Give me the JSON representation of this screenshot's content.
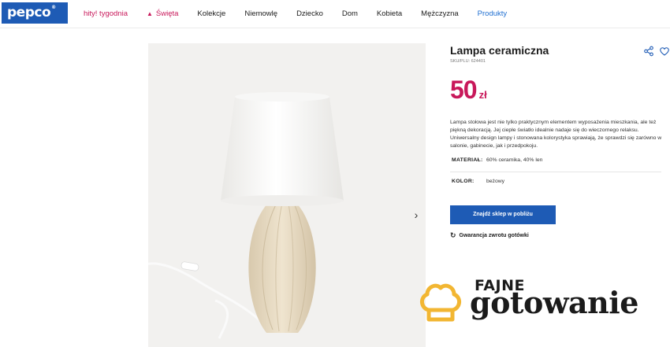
{
  "header": {
    "logo_text": "pepco",
    "logo_reg": "®",
    "nav": [
      {
        "label": "hity! tygodnia",
        "style": "promo"
      },
      {
        "label": "Święta",
        "style": "holiday"
      },
      {
        "label": "Kolekcje",
        "style": "normal"
      },
      {
        "label": "Niemowlę",
        "style": "normal"
      },
      {
        "label": "Dziecko",
        "style": "normal"
      },
      {
        "label": "Dom",
        "style": "normal"
      },
      {
        "label": "Kobieta",
        "style": "normal"
      },
      {
        "label": "Mężczyzna",
        "style": "normal"
      },
      {
        "label": "Produkty",
        "style": "active"
      }
    ]
  },
  "gallery": {
    "next_icon": "chevron-right-icon"
  },
  "product": {
    "title": "Lampa ceramiczna",
    "sku": "SKU/PLU: 624401",
    "price_value": "50",
    "price_currency": "zł",
    "description": "Lampa stołowa jest nie tylko praktycznym elementem wyposażenia mieszkania, ale też piękną dekoracją. Jej ciepłe światło idealnie nadaje się do wieczornego relaksu. Uniwersalny design lampy i stonowana kolorystyka sprawiają, że sprawdzi się zarówno w salonie, gabinecie, jak i przedpokoju.",
    "attributes": [
      {
        "key": "MATERIAŁ:",
        "value": "60% ceramika, 40% len"
      },
      {
        "key": "KOLOR:",
        "value": "beżowy"
      }
    ],
    "cta_label": "Znajdź sklep w pobliżu",
    "guarantee_label": "Gwarancja zwrotu gotówki"
  },
  "watermark": {
    "line1": "FAJNE",
    "line2": "gotowanie"
  },
  "colors": {
    "brand_blue": "#1e5bb5",
    "price_magenta": "#c8185a",
    "active_nav": "#1f6fd1",
    "watermark_gold": "#f2b632"
  }
}
